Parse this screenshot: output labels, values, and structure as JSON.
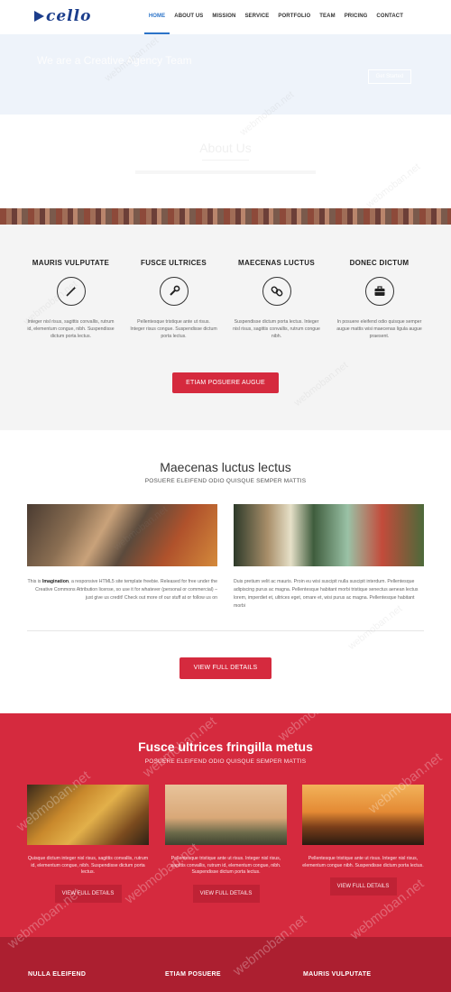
{
  "header": {
    "logo_text": "cello",
    "nav": [
      "HOME",
      "ABOUT US",
      "MISSION",
      "SERVICE",
      "PORTFOLIO",
      "TEAM",
      "PRICING",
      "CONTACT"
    ],
    "active_index": 0
  },
  "hero": {
    "title": "We are a Creative Agency Team",
    "button": "Get Started"
  },
  "about": {
    "title": "About Us"
  },
  "features": {
    "items": [
      {
        "title": "MAURIS VULPUTATE",
        "icon": "magic-wand-icon",
        "text": "Integer nisl risus, sagittis convallis, rutrum id, elementum congue, nibh. Suspendisse dictum porta lectus."
      },
      {
        "title": "FUSCE ULTRICES",
        "icon": "wrench-icon",
        "text": "Pellentesque tristique ante ut risus. Integer risus congue. Suspendisse dictum porta lectus."
      },
      {
        "title": "MAECENAS LUCTUS",
        "icon": "chain-link-icon",
        "text": "Suspendisse dictum porta lectus. Integer nisl risus, sagittis convallis, rutrum congue nibh."
      },
      {
        "title": "DONEC DICTUM",
        "icon": "briefcase-icon",
        "text": "In posuere eleifend odio quisque semper augue mattis wisi maecenas ligula augue praesent."
      }
    ],
    "button": "ETIAM POSUERE AUGUE"
  },
  "section2": {
    "title": "Maecenas luctus lectus",
    "subtitle": "POSUERE ELEIFEND ODIO QUISQUE SEMPER MATTIS",
    "left_text_pre": "This is ",
    "left_text_bold": "Imagination",
    "left_text_post": ", a responsive HTML5 site template freebie. Released for free under the Creative Commons Attribution license, so use it for whatever (personal or commercial) – just give us credit! Check out more of our stuff at or follow us on",
    "right_text": "Duis pretium velit ac mauris. Proin eu wisi suscipit nulla suscipit interdum. Pellentesque adipiscing purus ac magna. Pellentesque habitant morbi tristique senectus aenean lectus lorem, imperdiet et, ultrices eget, ornare et, wisi purus ac magna. Pellentesque habitant morbi",
    "button": "VIEW FULL DETAILS"
  },
  "section3": {
    "title": "Fusce ultrices fringilla metus",
    "subtitle": "POSUERE ELEIFEND ODIO QUISQUE SEMPER MATTIS",
    "cards": [
      {
        "text": "Quisque dictum integer nisl risus, sagittis convallis, rutrum id, elementum congue, nibh. Suspendisse dictum porta lectus.",
        "button": "VIEW FULL DETAILS"
      },
      {
        "text": "Pellentesque tristique ante ut risus. Integer nisl risus, sagittis convallis, rutrum id, elementum congue, nibh. Suspendisse dictum porta lectus.",
        "button": "VIEW FULL DETAILS"
      },
      {
        "text": "Pellentesque tristique ante ut risus. Integer nisl risus, elementum congue nibh. Suspendisse dictum porta lectus.",
        "button": "VIEW FULL DETAILS"
      }
    ]
  },
  "footer": {
    "headings": [
      "NULLA ELEIFEND",
      "ETIAM POSUERE",
      "MAURIS VULPUTATE"
    ]
  },
  "watermark": "webmoban.net",
  "colors": {
    "accent_red": "#d52a3e",
    "brand_blue": "#1c3e8c",
    "nav_active": "#2b73c8"
  }
}
